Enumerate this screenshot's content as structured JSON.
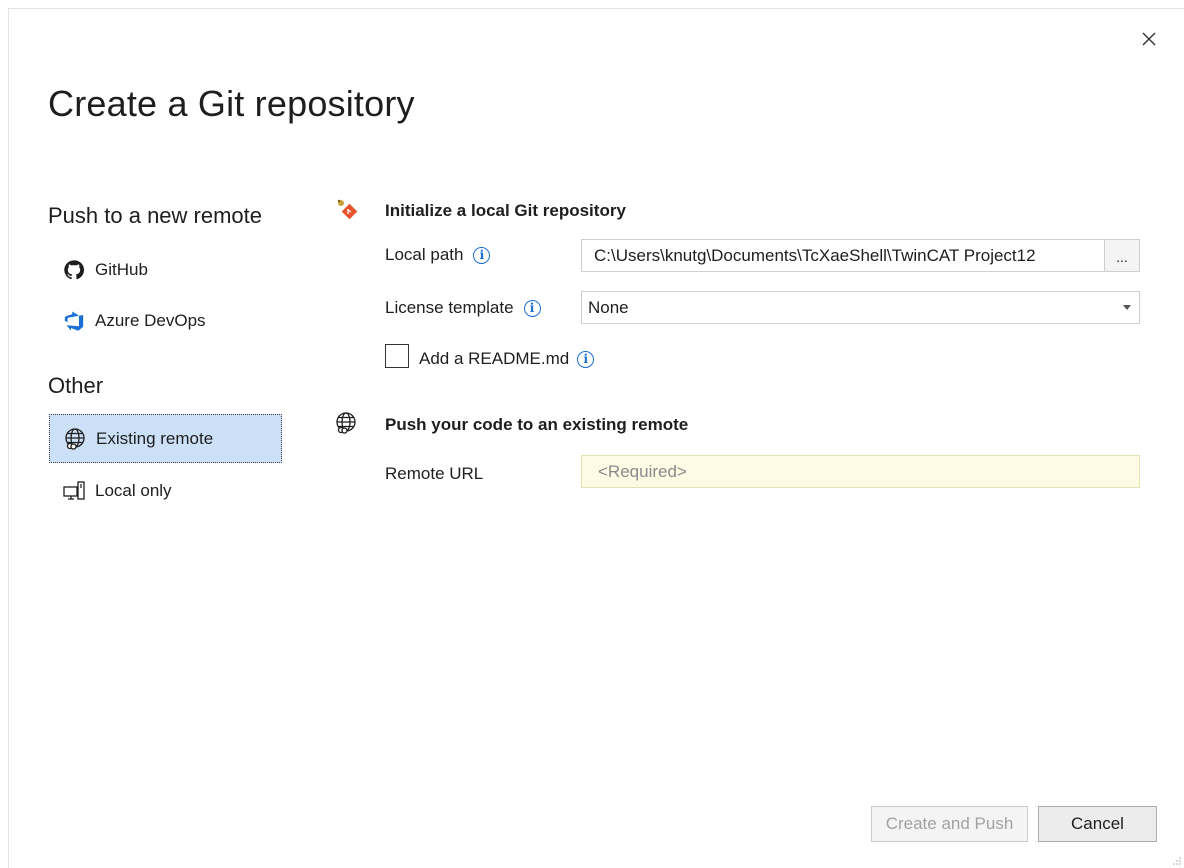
{
  "dialog": {
    "title": "Create a Git repository",
    "close_icon": "close-icon"
  },
  "sidebar": {
    "push_heading": "Push to a new remote",
    "other_heading": "Other",
    "items": [
      {
        "label": "GitHub",
        "icon": "github-icon"
      },
      {
        "label": "Azure DevOps",
        "icon": "azure-devops-icon"
      },
      {
        "label": "Existing remote",
        "icon": "globe-icon",
        "selected": true
      },
      {
        "label": "Local only",
        "icon": "computer-icon"
      }
    ]
  },
  "local_repo": {
    "title": "Initialize a local Git repository",
    "local_path_label": "Local path",
    "local_path_value": "C:\\Users\\knutg\\Documents\\TcXaeShell\\TwinCAT Project12",
    "browse_label": "...",
    "license_label": "License template",
    "license_value": "None",
    "readme_label": "Add a README.md",
    "readme_checked": false
  },
  "remote": {
    "title": "Push your code to an existing remote",
    "url_label": "Remote URL",
    "url_placeholder": "<Required>",
    "url_background": "#fdfbe3"
  },
  "footer": {
    "create_push_label": "Create and Push",
    "cancel_label": "Cancel"
  },
  "colors": {
    "accent": "#1a6fd6",
    "selected_bg": "#cce0f7"
  }
}
